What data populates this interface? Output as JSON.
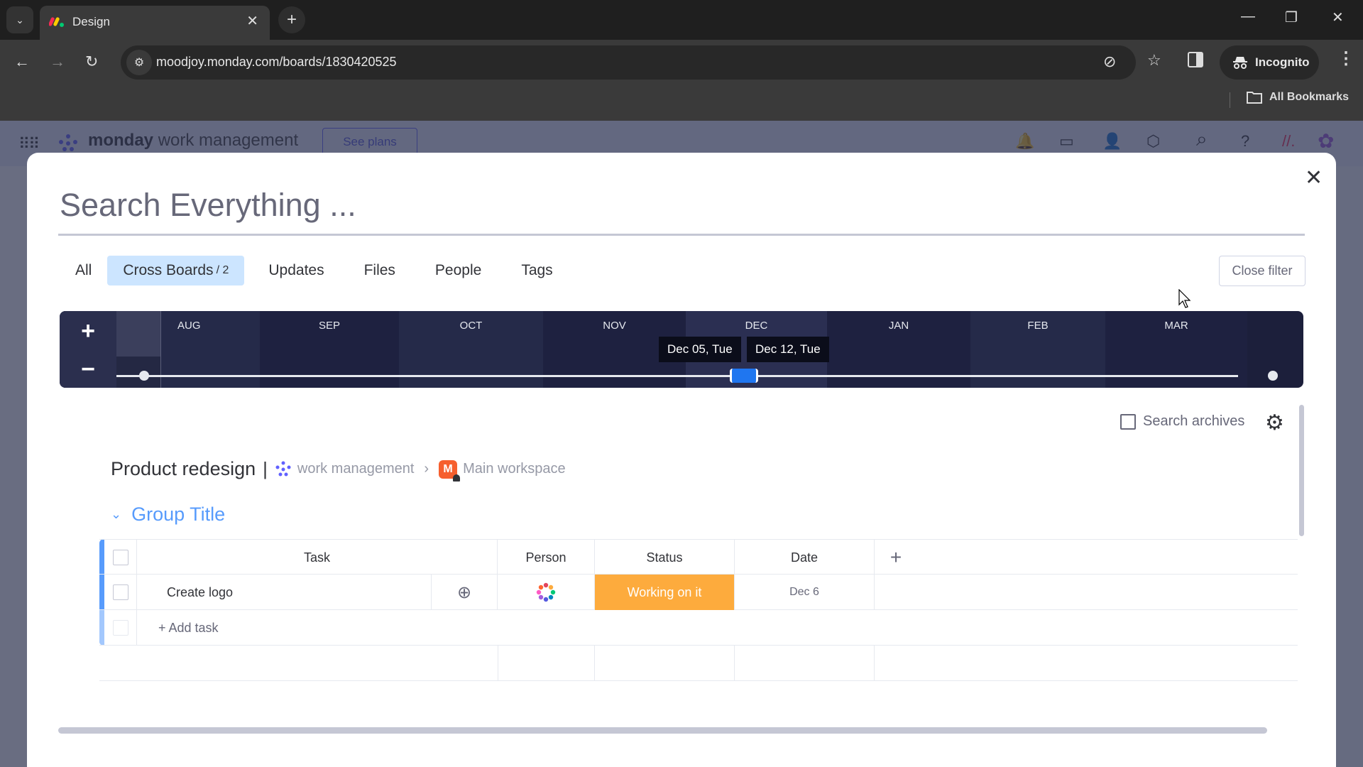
{
  "browser": {
    "tab_title": "Design",
    "url": "moodjoy.monday.com/boards/1830420525",
    "incognito_label": "Incognito",
    "bookmarks_label": "All Bookmarks"
  },
  "app_header": {
    "brand_bold": "monday",
    "brand_rest": "work management",
    "see_plans": "See plans"
  },
  "search": {
    "placeholder": "Search Everything ...",
    "value": ""
  },
  "filter_tabs": [
    {
      "label": "All",
      "count": ""
    },
    {
      "label": "Cross Boards",
      "count": "/ 2",
      "active": true
    },
    {
      "label": "Updates",
      "count": ""
    },
    {
      "label": "Files",
      "count": ""
    },
    {
      "label": "People",
      "count": ""
    },
    {
      "label": "Tags",
      "count": ""
    }
  ],
  "close_filter_label": "Close filter",
  "timeline": {
    "zoom_in": "+",
    "zoom_out": "−",
    "months": [
      "AUG",
      "SEP",
      "OCT",
      "NOV",
      "DEC",
      "JAN",
      "FEB",
      "MAR"
    ],
    "range_start_label": "Dec 05, Tue",
    "range_end_label": "Dec 12, Tue"
  },
  "search_archives": {
    "label": "Search archives",
    "checked": false
  },
  "result": {
    "board_name": "Product redesign",
    "separator": "|",
    "product_label": "work management",
    "workspace_initial": "M",
    "workspace_label": "Main workspace",
    "group_title": "Group Title",
    "group_color": "#579bfc",
    "columns": [
      "Task",
      "Person",
      "Status",
      "Date"
    ],
    "add_column_label": "+",
    "rows": [
      {
        "task": "Create logo",
        "person": "avatar",
        "status": "Working on it",
        "status_color": "#fdab3d",
        "date": "Dec 6"
      }
    ],
    "add_task_label": "+ Add task"
  },
  "icons": {
    "tab_dropdown": "⌄",
    "tab_close": "✕",
    "new_tab": "+",
    "minimize": "—",
    "restore": "❐",
    "window_close": "✕",
    "back": "←",
    "forward": "→",
    "reload": "↻",
    "site_info": "⚙",
    "eye_off": "⊘",
    "star": "☆",
    "menu": "⋮",
    "folder": "🗀",
    "modal_close": "✕",
    "gear": "⚙",
    "chevron_down": "⌄",
    "crumb_arrow": "›",
    "add_update": "⊕",
    "bell": "🔔",
    "search": "⌕",
    "help": "?"
  }
}
